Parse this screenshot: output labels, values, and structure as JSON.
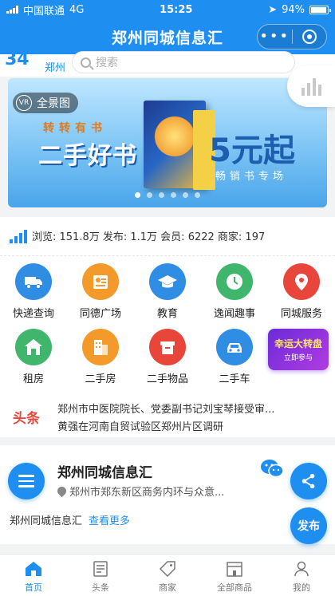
{
  "status_bar": {
    "carrier": "中国联通",
    "network": "4G",
    "time": "15:25",
    "battery": "94%"
  },
  "nav": {
    "title": "郑州同城信息汇",
    "menu_icon": "more-dots-icon",
    "close_icon": "target-close-icon"
  },
  "search": {
    "temperature": "34",
    "city": "郑州",
    "placeholder": "搜索"
  },
  "banner": {
    "vr_label": "全景图",
    "vr_badge": "VR",
    "subtitle": "转转有书",
    "headline": "二手好书",
    "price": "5元起",
    "tagline": "畅销书专场"
  },
  "stats": {
    "text": "浏览: 151.8万  发布: 1.1万  会员: 6222  商家: 197"
  },
  "services": [
    {
      "label": "快递查询",
      "icon": "truck-icon",
      "color": "#2f8de4"
    },
    {
      "label": "同德广场",
      "icon": "badge-icon",
      "color": "#f39a2b"
    },
    {
      "label": "教育",
      "icon": "graduation-cap-icon",
      "color": "#2f8de4"
    },
    {
      "label": "逸闻趣事",
      "icon": "clock-icon",
      "color": "#3fb66b"
    },
    {
      "label": "同城服务",
      "icon": "location-pin-icon",
      "color": "#e8463b"
    },
    {
      "label": "租房",
      "icon": "house-icon",
      "color": "#3fb66b"
    },
    {
      "label": "二手房",
      "icon": "building-icon",
      "color": "#f39a2b"
    },
    {
      "label": "二手物品",
      "icon": "box-icon",
      "color": "#e8463b"
    },
    {
      "label": "二手车",
      "icon": "car-icon",
      "color": "#2f8de4"
    }
  ],
  "lucky_wheel": {
    "title": "幸运大转盘",
    "sub": "立即参与"
  },
  "news": {
    "tag": "头条",
    "lines": [
      "郑州市中医院院长、党委副书记刘宝琴接受审...",
      "黄强在河南自贸试验区郑州片区调研"
    ]
  },
  "shop": {
    "name": "郑州同城信息汇",
    "address": "郑州市郑东新区商务内环与众意...",
    "footer_name": "郑州同城信息汇",
    "more_label": "查看更多"
  },
  "floating": {
    "post_label": "发布"
  },
  "tabbar": [
    {
      "label": "首页",
      "icon": "home-icon",
      "active": true
    },
    {
      "label": "头条",
      "icon": "news-icon",
      "active": false
    },
    {
      "label": "商家",
      "icon": "tag-icon",
      "active": false
    },
    {
      "label": "全部商品",
      "icon": "store-icon",
      "active": false
    },
    {
      "label": "我的",
      "icon": "user-icon",
      "active": false
    }
  ],
  "colors": {
    "primary": "#1f8ef1",
    "accent_red": "#e8463b"
  }
}
